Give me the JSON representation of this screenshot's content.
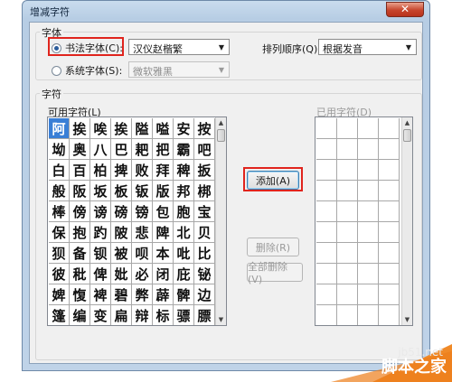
{
  "window": {
    "title": "增减字符",
    "close": "✕"
  },
  "font_group": {
    "legend": "字体",
    "calligraphy_radio": "书法字体(C):",
    "calligraphy_value": "汉仪赵楷繁",
    "system_radio": "系统字体(S):",
    "system_value": "微软雅黑",
    "sort_label": "排列顺序(Q):",
    "sort_value": "根据发音"
  },
  "chars_group": {
    "legend": "字符",
    "available_label": "可用字符(L)",
    "used_label": "已用字符(D)",
    "rows": [
      [
        "阿",
        "挨",
        "唉",
        "挨",
        "隘",
        "嗌",
        "安",
        "按"
      ],
      [
        "坳",
        "奥",
        "八",
        "巴",
        "耙",
        "把",
        "霸",
        "吧"
      ],
      [
        "白",
        "百",
        "柏",
        "捭",
        "败",
        "拜",
        "稗",
        "扳"
      ],
      [
        "般",
        "阪",
        "坂",
        "板",
        "钣",
        "版",
        "邦",
        "梆"
      ],
      [
        "棒",
        "傍",
        "谤",
        "磅",
        "镑",
        "包",
        "胞",
        "宝"
      ],
      [
        "保",
        "抱",
        "趵",
        "陂",
        "悲",
        "陴",
        "北",
        "贝"
      ],
      [
        "狈",
        "备",
        "钡",
        "被",
        "呗",
        "本",
        "吡",
        "比"
      ],
      [
        "彼",
        "秕",
        "俾",
        "妣",
        "必",
        "闭",
        "庇",
        "铋"
      ],
      [
        "婢",
        "愎",
        "裨",
        "碧",
        "弊",
        "薜",
        "髀",
        "边"
      ],
      [
        "篷",
        "编",
        "变",
        "扁",
        "辩",
        "标",
        "骠",
        "膘"
      ]
    ]
  },
  "buttons": {
    "add": "添加(A)",
    "delete": "删除(R)",
    "delete_all": "全部删除(V)"
  },
  "watermark": {
    "top": "jb51.net",
    "bottom": "脚本之家"
  },
  "colors": {
    "highlight": "#e0241d",
    "selection": "#3a7fd6"
  }
}
